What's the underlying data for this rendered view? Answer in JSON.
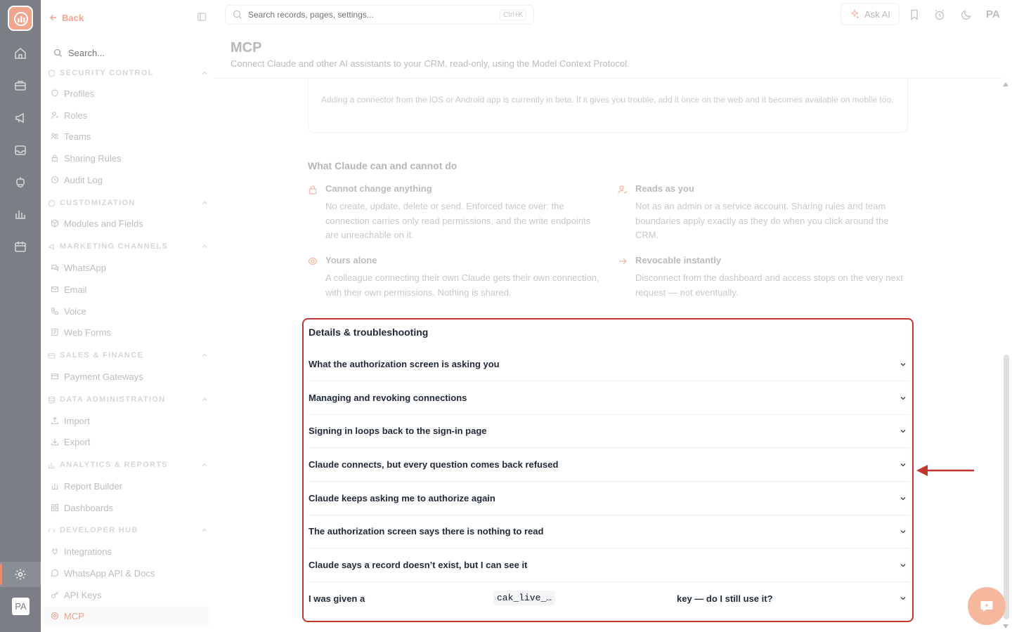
{
  "sidebar": {
    "back_label": "Back",
    "search_placeholder": "Search...",
    "sections": {
      "security": "SECURITY CONTROL",
      "customization": "CUSTOMIZATION",
      "marketing": "MARKETING CHANNELS",
      "sales": "SALES & FINANCE",
      "data_admin": "DATA ADMINISTRATION",
      "analytics": "ANALYTICS & REPORTS",
      "developer": "DEVELOPER HUB"
    },
    "items": {
      "profiles": "Profiles",
      "roles": "Roles",
      "teams": "Teams",
      "sharing_rules": "Sharing Rules",
      "audit_log": "Audit Log",
      "modules_fields": "Modules and Fields",
      "whatsapp": "WhatsApp",
      "email": "Email",
      "voice": "Voice",
      "web_forms": "Web Forms",
      "payment_gateways": "Payment Gateways",
      "import": "Import",
      "export": "Export",
      "report_builder": "Report Builder",
      "dashboards": "Dashboards",
      "integrations": "Integrations",
      "whatsapp_api": "WhatsApp API & Docs",
      "api_keys": "API Keys",
      "mcp": "MCP"
    }
  },
  "rail": {
    "avatar": "PA"
  },
  "topbar": {
    "search_placeholder": "Search records, pages, settings...",
    "shortcut": "Ctrl+K",
    "ask_ai": "Ask AI",
    "avatar": "PA"
  },
  "header": {
    "title": "MCP",
    "subtitle": "Connect Claude and other AI assistants to your CRM, read-only, using the Model Context Protocol."
  },
  "beta_note": "Adding a connector from the iOS or Android app is currently in beta. If it gives you trouble, add it once on the web and it becomes available on mobile too.",
  "capabilities": {
    "title": "What Claude can and cannot do",
    "items": [
      {
        "title": "Cannot change anything",
        "body": "No create, update, delete or send. Enforced twice over: the connection carries only read permissions, and the write endpoints are unreachable on it."
      },
      {
        "title": "Reads as you",
        "body": "Not as an admin or a service account. Sharing rules and team boundaries apply exactly as they do when you click around the CRM."
      },
      {
        "title": "Yours alone",
        "body": "A colleague connecting their own Claude gets their own connection, with their own permissions. Nothing is shared."
      },
      {
        "title": "Revocable instantly",
        "body": "Disconnect from the dashboard and access stops on the very next request — not eventually."
      }
    ]
  },
  "details": {
    "title": "Details & troubleshooting",
    "items": [
      "What the authorization screen is asking you",
      "Managing and revoking connections",
      "Signing in loops back to the sign-in page",
      "Claude connects, but every question comes back refused",
      "Claude keeps asking me to authorize again",
      "The authorization screen says there is nothing to read",
      "Claude says a record doesn’t exist, but I can see it"
    ],
    "last": {
      "prefix": "I was given a",
      "code": "cak_live_…",
      "suffix": "key — do I still use it?"
    }
  },
  "colors": {
    "accent": "#f08a6d",
    "annotation": "#c0362c",
    "rail": "#7b7e85"
  }
}
